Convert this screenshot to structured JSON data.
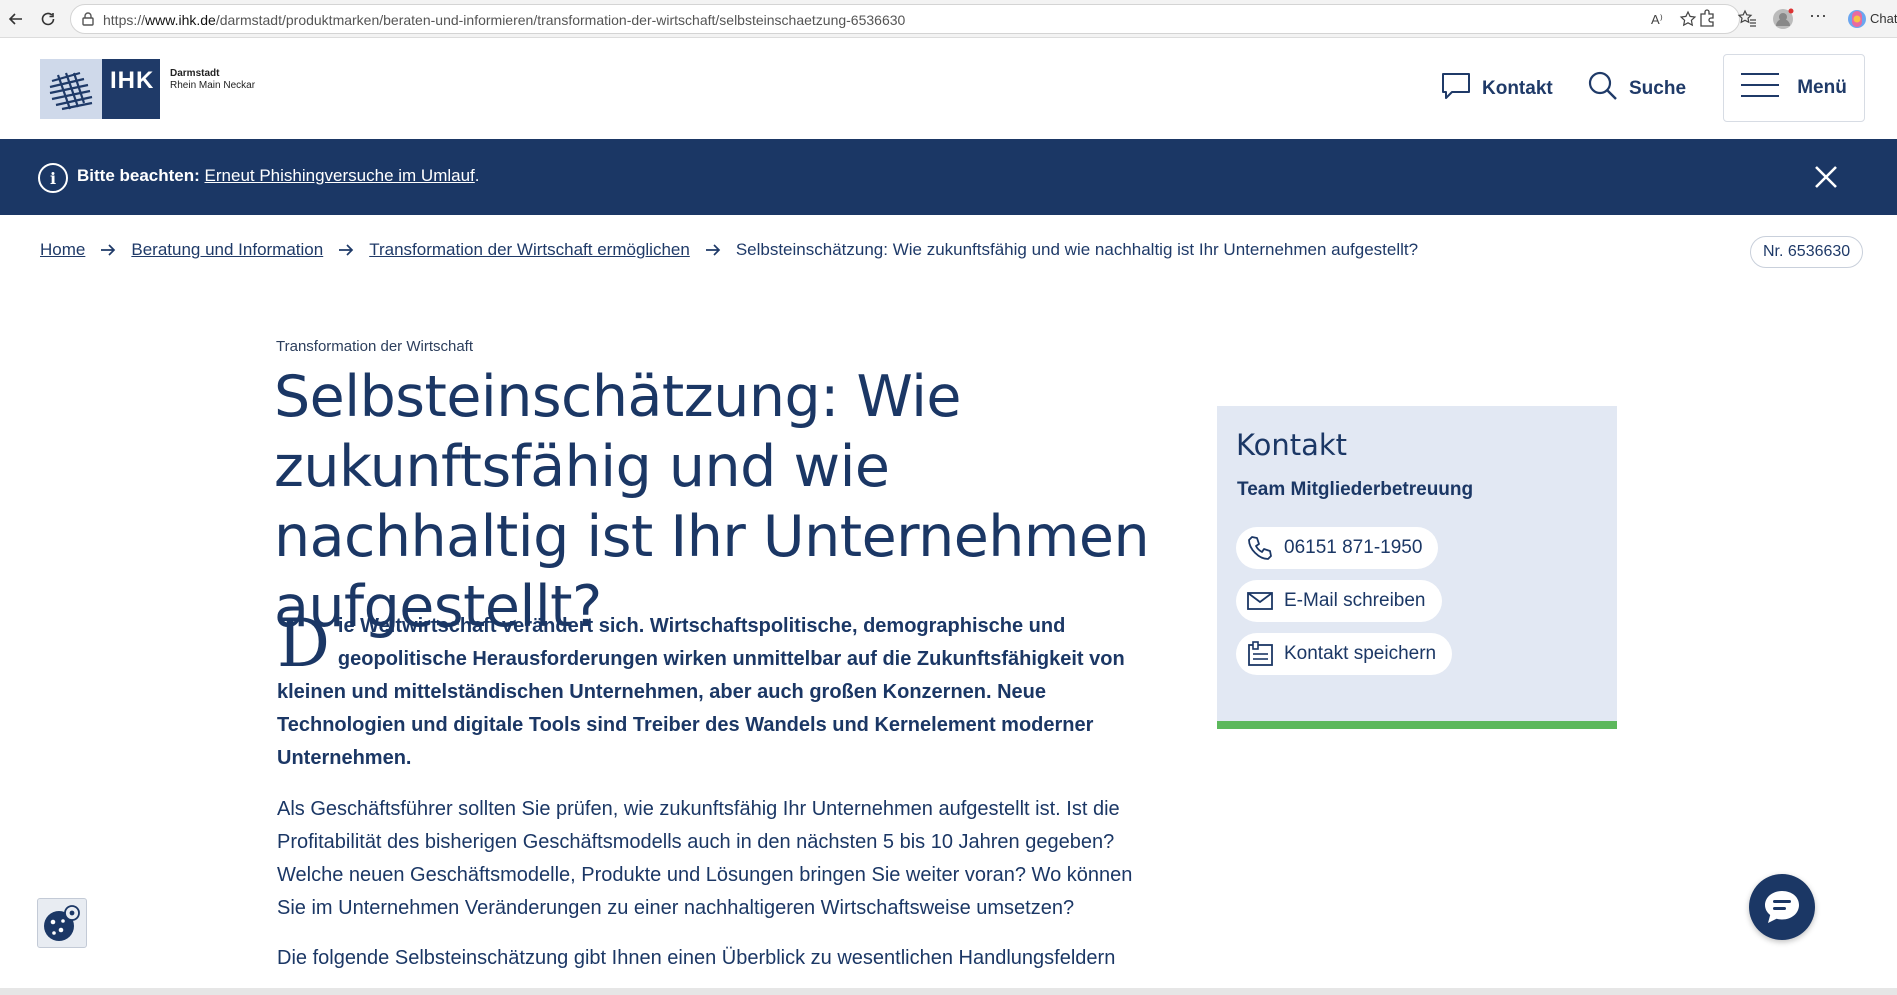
{
  "browser": {
    "url_prefix": "https://",
    "url_host": "www.ihk.de",
    "url_path": "/darmstadt/produktmarken/beraten-und-informieren/transformation-der-wirtschaft/selbsteinschaetzung-6536630",
    "read_aloud_label": "A⁾",
    "copilot_label": "Chat"
  },
  "header": {
    "logo_text": "IHK",
    "logo_city": "Darmstadt",
    "logo_region": "Rhein Main Neckar",
    "contact_label": "Kontakt",
    "search_label": "Suche",
    "menu_label": "Menü"
  },
  "alert": {
    "icon": "info-icon",
    "prefix": "Bitte beachten:",
    "link_text": "Erneut Phishingversuche im Umlauf",
    "suffix": "."
  },
  "breadcrumb": {
    "items": [
      "Home",
      "Beratung und Information",
      "Transformation der Wirtschaft ermöglichen"
    ],
    "current": "Selbsteinschätzung: Wie zukunftsfähig und wie nachhaltig ist Ihr Unternehmen aufgestellt?",
    "number": "Nr. 6536630"
  },
  "article": {
    "kicker": "Transformation der Wirtschaft",
    "title": "Selbsteinschätzung: Wie zukunftsfähig und wie nachhaltig ist Ihr Unternehmen aufgestellt?",
    "lead_dropcap": "D",
    "lead_rest": "ie Weltwirtschaft verändert sich. Wirtschaftspolitische, demographische und geopolitische Herausforderungen wirken unmittelbar auf die Zukunftsfähigkeit von kleinen und mittelständischen Unternehmen, aber auch großen Konzernen. Neue Technologien und digitale Tools sind Treiber des Wandels und Kernelement moderner Unternehmen.",
    "paragraph_1": "Als Geschäftsführer sollten Sie prüfen, wie zukunftsfähig Ihr Unternehmen aufgestellt ist. Ist die Profitabilität des bisherigen Geschäftsmodells auch in den nächsten 5 bis 10 Jahren gegeben? Welche neuen Geschäftsmodelle, Produkte und Lösungen bringen Sie weiter voran? Wo können Sie im Unternehmen Veränderungen zu einer nachhaltigeren Wirtschaftsweise umsetzen?",
    "paragraph_2": "Die folgende Selbsteinschätzung gibt Ihnen einen Überblick zu wesentlichen Handlungsfeldern"
  },
  "contact_card": {
    "title": "Kontakt",
    "team": "Team Mitgliederbetreuung",
    "phone": "06151 871-1950",
    "email_label": "E-Mail schreiben",
    "save_label": "Kontakt speichern"
  },
  "colors": {
    "brand_navy": "#1b3765",
    "card_bg": "#e2e8f3",
    "card_accent": "#5cb85c"
  }
}
